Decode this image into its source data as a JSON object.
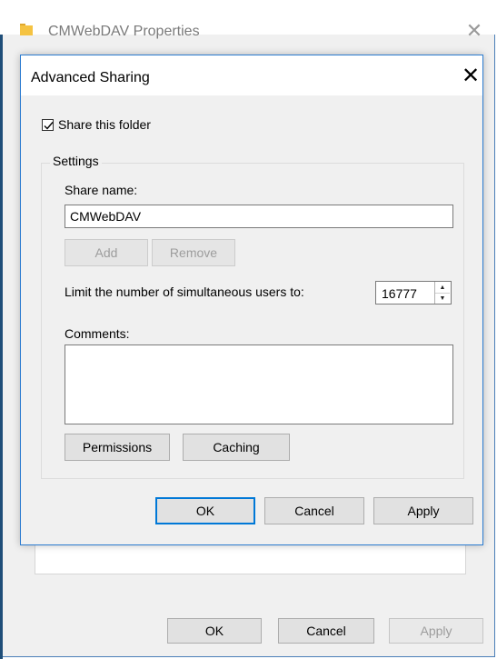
{
  "outer_window": {
    "title": "CMWebDAV Properties",
    "buttons": {
      "ok": "OK",
      "cancel": "Cancel",
      "apply": "Apply"
    }
  },
  "dialog": {
    "title": "Advanced Sharing",
    "share_checkbox": {
      "label": "Share this folder",
      "checked": true
    },
    "settings": {
      "legend": "Settings",
      "share_name_label": "Share name:",
      "share_name_value": "CMWebDAV",
      "add_label": "Add",
      "remove_label": "Remove",
      "limit_label": "Limit the number of simultaneous users to:",
      "limit_value": "16777",
      "comments_label": "Comments:",
      "comments_value": "",
      "permissions_label": "Permissions",
      "caching_label": "Caching"
    },
    "buttons": {
      "ok": "OK",
      "cancel": "Cancel",
      "apply": "Apply"
    }
  },
  "colors": {
    "accent": "#0078d7",
    "folder_icon": "#f5c342",
    "window_border": "#2b7bd0"
  },
  "icons": [
    "folder-icon",
    "close-icon",
    "checkmark-icon",
    "spin-up-icon",
    "spin-down-icon"
  ]
}
